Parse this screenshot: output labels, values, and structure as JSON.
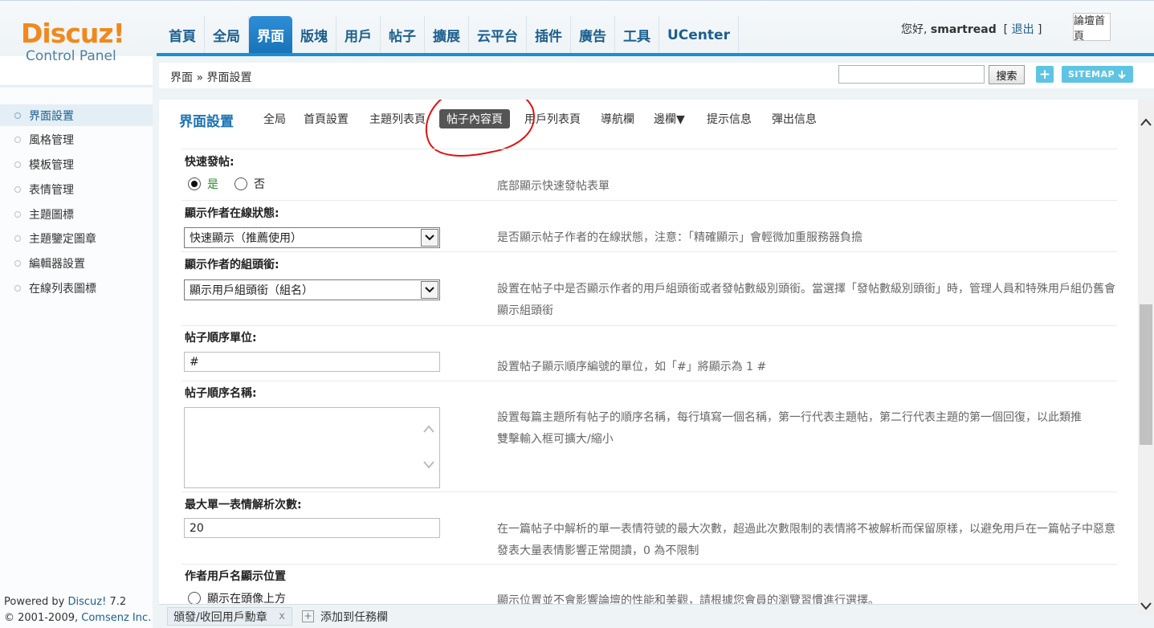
{
  "logo": {
    "brand": "Discuz!",
    "sub": "Control Panel"
  },
  "nav": {
    "tabs": [
      "首頁",
      "全局",
      "界面",
      "版塊",
      "用戶",
      "帖子",
      "擴展",
      "云平台",
      "插件",
      "廣告",
      "工具",
      "UCenter"
    ],
    "active": "界面"
  },
  "header": {
    "greeting": "您好,",
    "username": "smartread",
    "logout_prefix": "[",
    "logout": "退出",
    "logout_suffix": "]",
    "home_button": "論壇首頁"
  },
  "breadcrumb": {
    "text": "界面 » 界面設置"
  },
  "search": {
    "value": "",
    "button": "搜索"
  },
  "plus_label": "+",
  "sitemap_label": "SITEMAP",
  "sidebar": {
    "items": [
      "界面設置",
      "風格管理",
      "模板管理",
      "表情管理",
      "主題圖標",
      "主題鑒定圖章",
      "編輯器設置",
      "在線列表圖標"
    ]
  },
  "copyright": {
    "line1_prefix": "Powered by",
    "line1_brand": "Discuz!",
    "line1_version": "7.2",
    "line2_prefix": "© 2001-2009,",
    "line2_company": "Comsenz Inc."
  },
  "page": {
    "title": "界面設置",
    "subtabs": [
      "全局",
      "首頁設置",
      "主題列表頁",
      "帖子內容頁",
      "用戶列表頁",
      "導航欄",
      "邊欄▼",
      "提示信息",
      "彈出信息"
    ],
    "active_subtab": "帖子內容頁"
  },
  "fields": {
    "quick_post": {
      "label": "快速發帖:",
      "yes": "是",
      "no": "否",
      "selected": "是",
      "desc": "底部顯示快速發帖表單"
    },
    "online_status": {
      "label": "顯示作者在線狀態:",
      "value": "快速顯示（推薦使用）",
      "desc": "是否顯示帖子作者的在線狀態，注意：「精確顯示」會輕微加重服務器負擔"
    },
    "group_title": {
      "label": "顯示作者的組頭銜:",
      "value": "顯示用戶組頭銜（組名）",
      "desc": "設置在帖子中是否顯示作者的用戶組頭銜或者發帖數級別頭銜。當選擇「發帖數級別頭銜」時，管理人員和特殊用戶組仍舊會顯示組頭銜"
    },
    "post_unit": {
      "label": "帖子順序單位:",
      "value": "#",
      "desc": "設置帖子顯示順序編號的單位，如「#」將顯示為 1 #"
    },
    "post_names": {
      "label": "帖子順序名稱:",
      "value": "",
      "desc1": "設置每篇主題所有帖子的順序名稱，每行填寫一個名稱，第一行代表主題帖，第二行代表主題的第一個回復，以此類推",
      "desc2": "雙擊輸入框可擴大/縮小"
    },
    "smiley_max": {
      "label": "最大單一表情解析次數:",
      "value": "20",
      "desc": "在一篇帖子中解析的單一表情符號的最大次數，超過此次數限制的表情將不被解析而保留原樣，以避免用戶在一篇帖子中惡意發表大量表情影響正常閱讀，0 為不限制"
    },
    "author_pos": {
      "label": "作者用戶名顯示位置",
      "option1": "顯示在頭像上方",
      "desc": "顯示位置並不會影響論壇的性能和美觀，請根據您會員的瀏覽習慣進行選擇。"
    }
  },
  "statusbar": {
    "task": "頒發/收回用戶勳章",
    "close": "x",
    "add_plus": "+",
    "add": "添加到任務欄"
  }
}
